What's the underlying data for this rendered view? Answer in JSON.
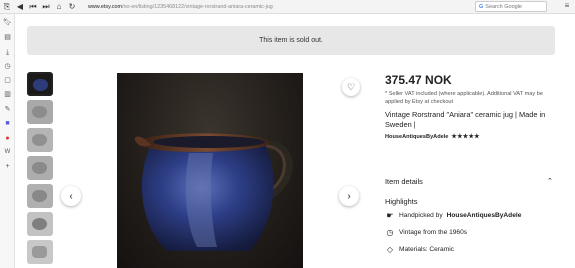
{
  "browser": {
    "url_host": "www.etsy.com",
    "url_path": "/no-en/listing/1235468122/vintage-rorstrand-aniara-ceramic-jug",
    "search_placeholder": "Search Google"
  },
  "banner": {
    "text": "This item is sold out."
  },
  "listing": {
    "price": "375.47 NOK",
    "vat_note": "* Seller VAT included (where applicable). Additional VAT may be applied by Etsy at checkout",
    "title": "Vintage Rorstrand \"Aniara\" ceramic jug | Made in Sweden |",
    "shop_name": "HouseAntiquesByAdele",
    "stars": "★★★★★"
  },
  "details": {
    "heading": "Item details",
    "highlights_heading": "Highlights",
    "handpicked_prefix": "Handpicked by",
    "handpicked_by": "HouseAntiquesByAdele",
    "vintage": "Vintage from the 1960s",
    "materials": "Materials: Ceramic"
  },
  "colors": {
    "jug_blue": "#2a3a78",
    "jug_rim": "#5a3322",
    "background": "#231e1a"
  }
}
